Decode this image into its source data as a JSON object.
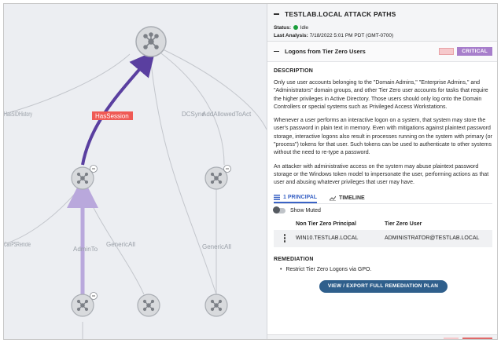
{
  "graph": {
    "edges": {
      "has_session": "HasSession",
      "history": "HasSIDHistory",
      "dcsync": "DCSync",
      "add_allowed": "AddAllowedToAct",
      "can_remote": "CanPSRemote",
      "admin_to": "AdminTo",
      "generic_all_1": "GenericAll",
      "generic_all_2": "GenericAll"
    }
  },
  "panel": {
    "title": "TESTLAB.LOCAL ATTACK PATHS",
    "status_label": "Status:",
    "status_value": "Idle",
    "analysis_label": "Last Analysis:",
    "analysis_value": "7/18/2022 5:01 PM PDT (GMT-0700)",
    "finding": {
      "title": "Logons from Tier Zero Users",
      "severity": "CRITICAL"
    },
    "description_label": "DESCRIPTION",
    "paragraphs": [
      "Only use user accounts belonging to the \"Domain Admins,\" \"Enterprise Admins,\" and \"Administrators\" domain groups, and other Tier Zero user accounts for tasks that require the higher privileges in Active Directory. Those users should only log onto the Domain Controllers or special systems such as Privileged Access Workstations.",
      "Whenever a user performs an interactive logon on a system, that system may store the user's password in plain text in memory. Even with mitigations against plaintext password storage, interactive logons also result in processes running on the system with primary (or \"process\") tokens for that user. Such tokens can be used to authenticate to other systems without the need to re-type a password.",
      "An attacker with administrative access on the system may abuse plaintext password storage or the Windows token model to impersonate the user, performing actions as that user and abusing whatever privileges that user may have."
    ],
    "tabs": {
      "principal": "1 PRINCIPAL",
      "timeline": "TIMELINE"
    },
    "show_muted": "Show Muted",
    "table": {
      "col1": "Non Tier Zero Principal",
      "col2": "Tier Zero User",
      "rows": [
        {
          "principal": "WIN10.TESTLAB.LOCAL",
          "user": "ADMINISTRATOR@TESTLAB.LOCAL"
        }
      ]
    },
    "remediation_label": "REMEDIATION",
    "remediation_items": [
      "Restrict Tier Zero Logons via GPO."
    ],
    "remediation_button": "VIEW / EXPORT FULL REMEDIATION PLAN"
  },
  "colors": {
    "attack_path": "#5a3fa0",
    "admin_to_edge": "#b9a8dc",
    "critical": "#a77ecb",
    "button": "#2f5f8c"
  }
}
